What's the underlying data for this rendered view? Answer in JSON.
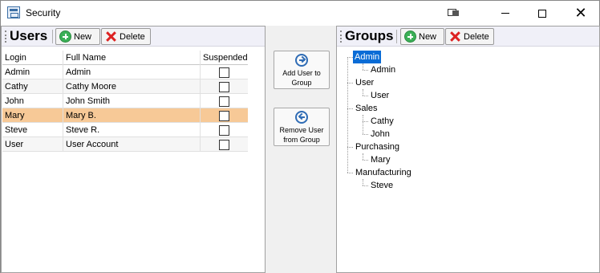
{
  "window": {
    "title": "Security"
  },
  "users_panel": {
    "title": "Users",
    "new_label": "New",
    "delete_label": "Delete",
    "columns": [
      "Login",
      "Full Name",
      "Suspended"
    ],
    "rows": [
      {
        "login": "Admin",
        "full_name": "Admin",
        "suspended": false
      },
      {
        "login": "Cathy",
        "full_name": "Cathy Moore",
        "suspended": false
      },
      {
        "login": "John",
        "full_name": "John Smith",
        "suspended": false
      },
      {
        "login": "Mary",
        "full_name": "Mary B.",
        "suspended": false,
        "selected": true
      },
      {
        "login": "Steve",
        "full_name": "Steve R.",
        "suspended": false
      },
      {
        "login": "User",
        "full_name": "User Account",
        "suspended": false
      }
    ]
  },
  "actions": {
    "add_label": "Add User to\nGroup",
    "remove_label": "Remove User\nfrom Group"
  },
  "groups_panel": {
    "title": "Groups",
    "new_label": "New",
    "delete_label": "Delete",
    "groups": [
      {
        "name": "Admin",
        "selected": true,
        "members": [
          "Admin"
        ]
      },
      {
        "name": "User",
        "members": [
          "User"
        ]
      },
      {
        "name": "Sales",
        "members": [
          "Cathy",
          "John"
        ]
      },
      {
        "name": "Purchasing",
        "members": [
          "Mary"
        ]
      },
      {
        "name": "Manufacturing",
        "members": [
          "Steve"
        ]
      }
    ]
  },
  "colors": {
    "selected_row": "#f7c997",
    "tree_selection": "#0a6cd6",
    "toolbar_bg": "#f0f0f8",
    "new_icon": "#3bb057",
    "delete_icon": "#dd2222",
    "arrow_icon": "#2f6cb5"
  },
  "icons": {
    "app": "window-app-icon",
    "new": "plus-circle-icon",
    "delete": "red-x-icon",
    "add": "arrow-right-circle-icon",
    "remove": "arrow-left-circle-icon"
  }
}
